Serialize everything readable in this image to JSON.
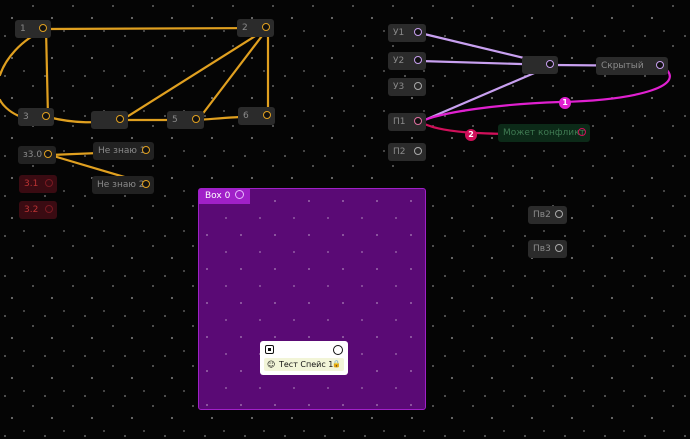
{
  "colors": {
    "wire_orange": "#e0a020",
    "wire_lavender": "#c8a0f0",
    "wire_magenta": "#e020d0",
    "wire_crimson": "#d0105a",
    "box_fill": "#5a0a75",
    "box_border": "#a020c8"
  },
  "nodes": {
    "n1": "1",
    "n2": "2",
    "n3": "3",
    "n4": "",
    "n5": "5",
    "n6": "6",
    "z30": "з3.0",
    "ne_znayu_1": "Не знаю 1",
    "ne_znayu_2": "Не знаю 2",
    "n31": "3.1",
    "n32": "3.2",
    "u1": "У1",
    "u2": "У2",
    "u3": "У3",
    "p1": "П1",
    "p2": "П2",
    "mid_node": "",
    "right_node": "Скрытый",
    "green_node": "Может конфликт",
    "pv2": "Пв2",
    "pv3": "Пв3"
  },
  "badges": {
    "b1": "1",
    "b2": "2"
  },
  "box": {
    "title": "Box 0"
  },
  "card": {
    "emoji": "☺",
    "label": "Тест Спейс 1",
    "lock_icon": "🔒"
  }
}
